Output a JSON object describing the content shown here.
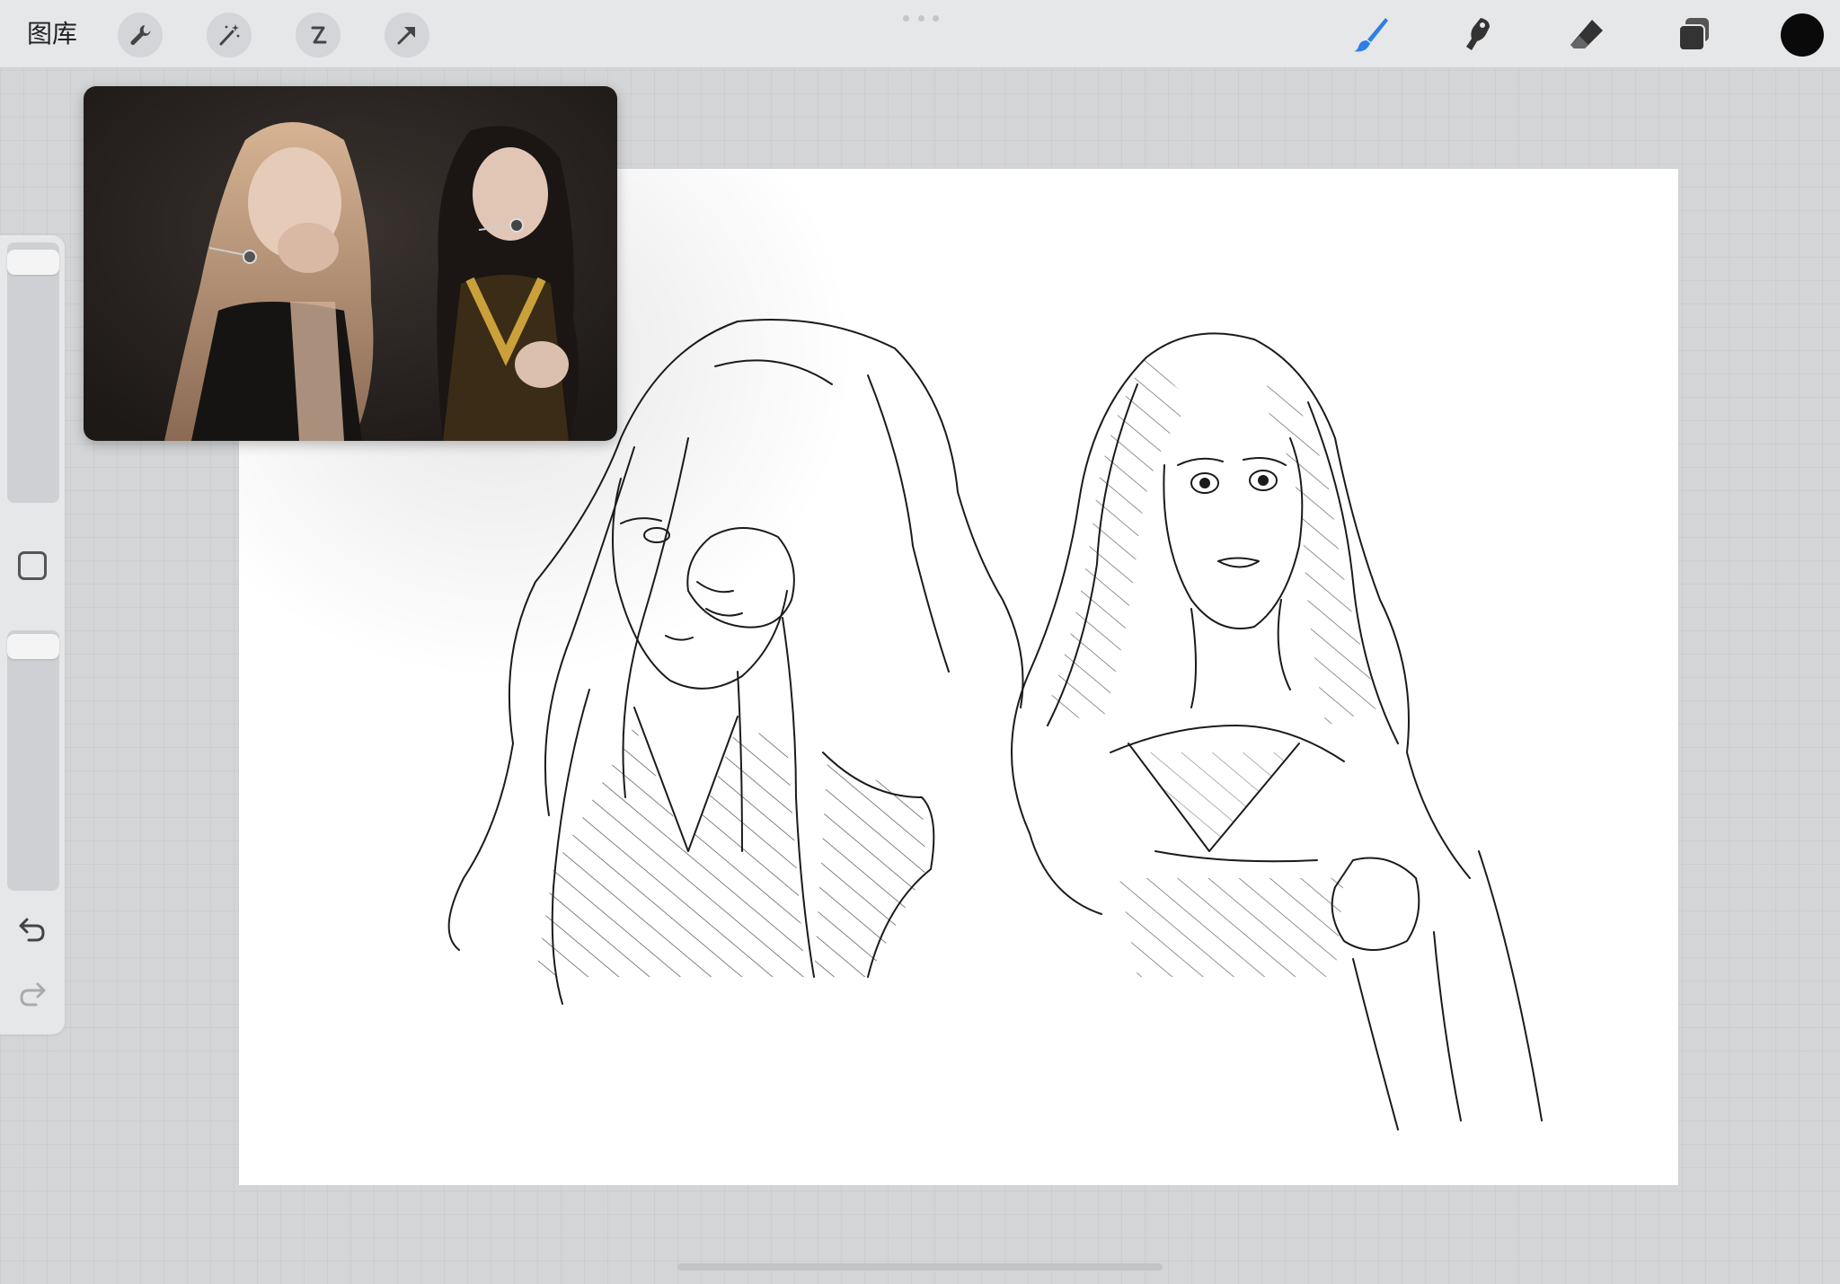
{
  "toolbar": {
    "gallery_label": "图库",
    "left_tools": [
      "wrench-icon",
      "magic-wand-icon",
      "selection-icon",
      "transform-arrow-icon"
    ],
    "right_tools": [
      "brush-icon",
      "smudge-icon",
      "eraser-icon",
      "layers-icon"
    ],
    "active_tool": "brush-icon",
    "active_color": "#0a0a0a",
    "accent_color": "#2f7fe6"
  },
  "sidebar": {
    "controls": [
      "brush-size-slider",
      "modify-button",
      "opacity-slider",
      "undo-icon",
      "redo-icon"
    ]
  },
  "reference_window": {
    "content": "photo-reference"
  }
}
